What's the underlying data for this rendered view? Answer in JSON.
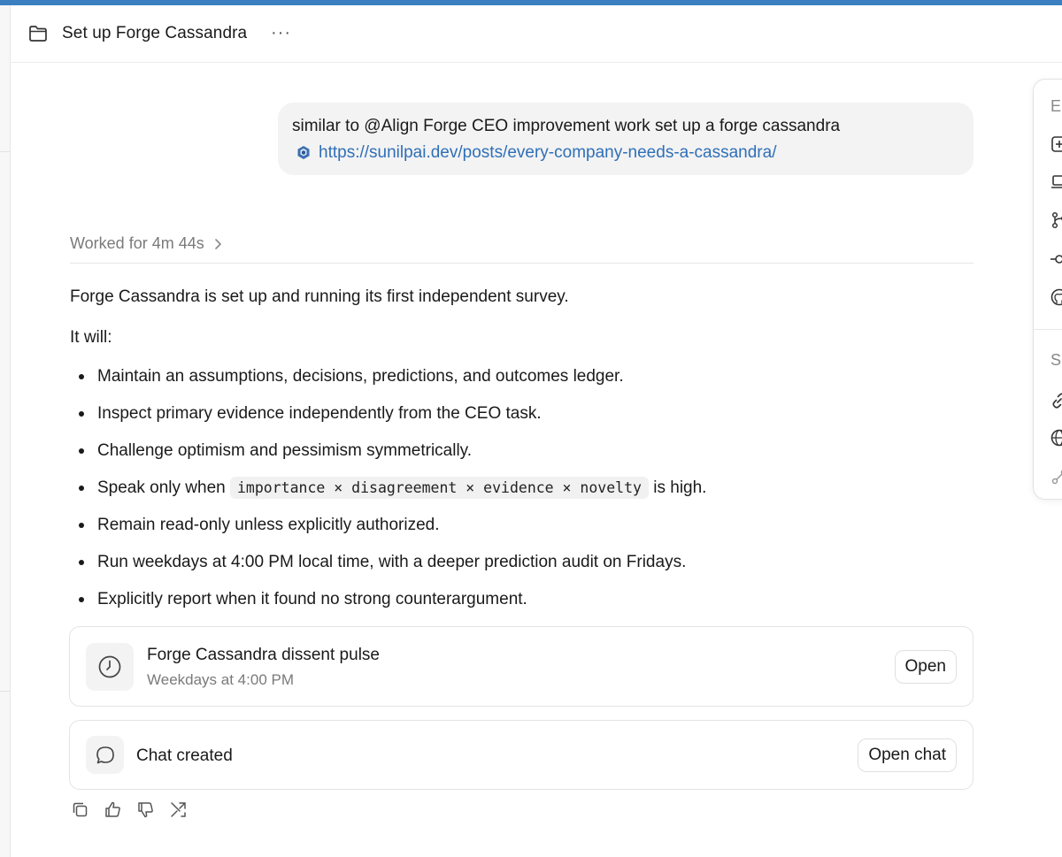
{
  "header": {
    "title": "Set up Forge Cassandra",
    "more_label": "···"
  },
  "side_panel": {
    "label_top": "E",
    "label_mid": "S"
  },
  "user_message": {
    "text": "similar to @Align Forge CEO improvement work set up a forge cassandra",
    "link": "https://sunilpai.dev/posts/every-company-needs-a-cassandra/"
  },
  "worked": {
    "label": "Worked for 4m 44s"
  },
  "response": {
    "intro": "Forge Cassandra is set up and running its first independent survey.",
    "it_will": "It will:",
    "bullets": [
      "Maintain an assumptions, decisions, predictions, and outcomes ledger.",
      "Inspect primary evidence independently from the CEO task.",
      "Challenge optimism and pessimism symmetrically.",
      "Remain read-only unless explicitly authorized.",
      "Run weekdays at 4:00 PM local time, with a deeper prediction audit on Fridays.",
      "Explicitly report when it found no strong counterargument."
    ],
    "speak": {
      "before": "Speak only when ",
      "code": "importance × disagreement × evidence × novelty",
      "after": " is high."
    }
  },
  "schedule_card": {
    "title": "Forge Cassandra dissent pulse",
    "subtitle": "Weekdays at 4:00 PM",
    "button": "Open"
  },
  "chat_card": {
    "title": "Chat created",
    "button": "Open chat"
  },
  "colors": {
    "accent_bar": "#3b7fc0",
    "link": "#2f6fb8",
    "bubble_bg": "#f3f3f3"
  }
}
